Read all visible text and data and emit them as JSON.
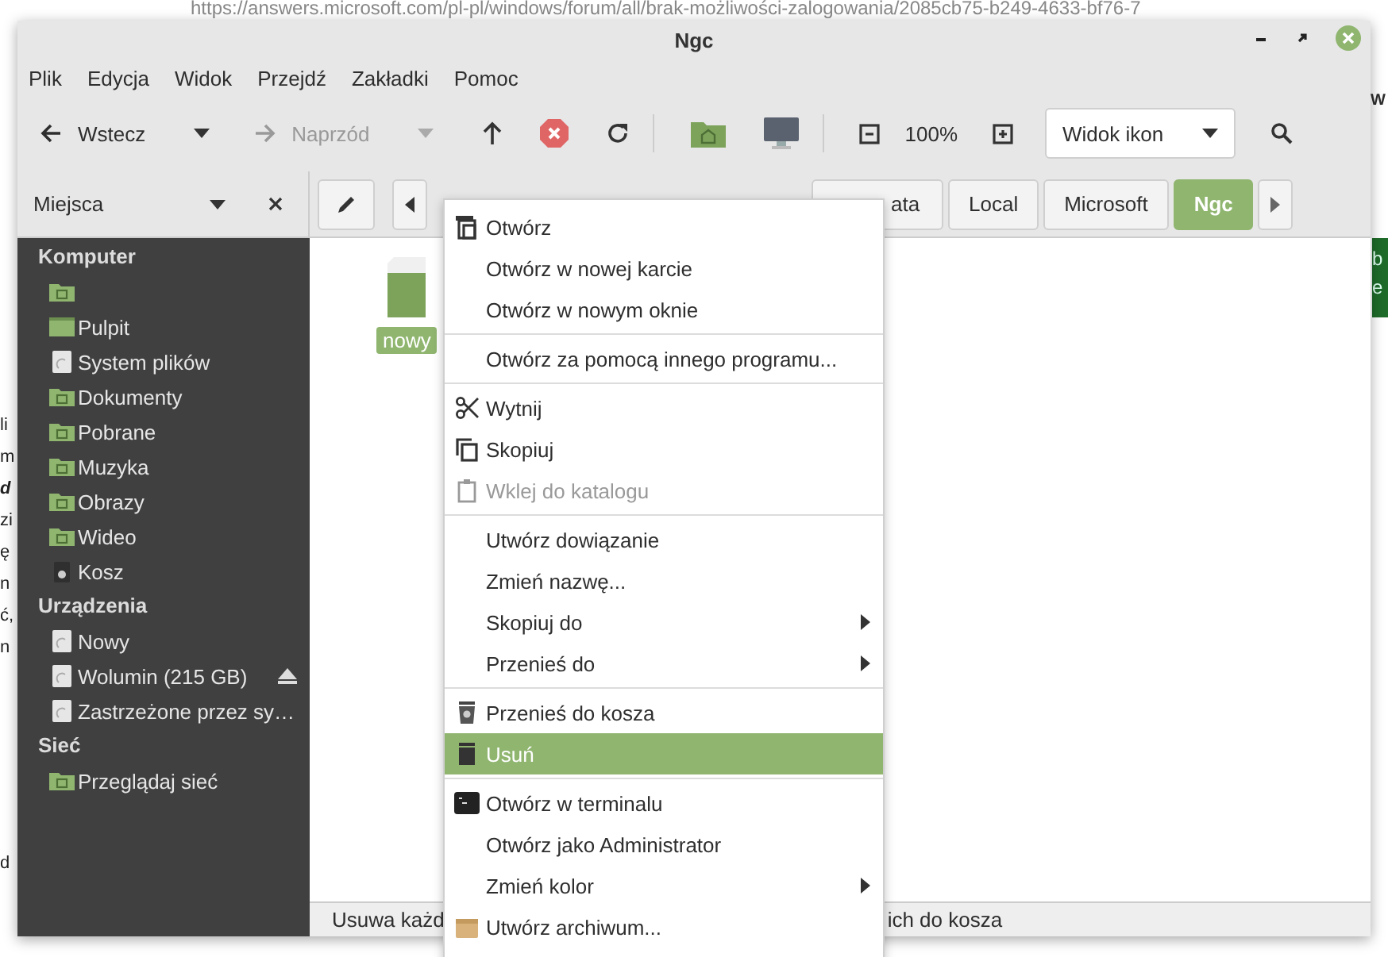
{
  "browser": {
    "url": "https://answers.microsoft.com/pl-pl/windows/forum/all/brak-możliwości-zalogowania/2085cb75-b249-4633-bf76-7",
    "left_fragments": [
      "li",
      "m",
      "d",
      "zi",
      "ę",
      "n",
      "ć,",
      "n"
    ],
    "bottom_fragment": "d",
    "right_fragment": "W",
    "right_box": [
      "b",
      "e"
    ]
  },
  "window": {
    "title": "Ngc"
  },
  "menubar": [
    "Plik",
    "Edycja",
    "Widok",
    "Przejdź",
    "Zakładki",
    "Pomoc"
  ],
  "toolbar": {
    "back": {
      "label": "Wstecz",
      "disabled": false
    },
    "forward": {
      "label": "Naprzód",
      "disabled": true
    },
    "zoom": "100%",
    "view": "Widok ikon"
  },
  "sidebar": {
    "title": "Miejsca",
    "sections": [
      {
        "heading": "Komputer",
        "items": [
          {
            "ejectable": false
          },
          {
            "label": "Pulpit",
            "ejectable": false
          },
          {
            "label": "System plików",
            "ejectable": false
          },
          {
            "label": "Dokumenty",
            "ejectable": false
          },
          {
            "label": "Pobrane",
            "ejectable": false
          },
          {
            "label": "Muzyka",
            "ejectable": false
          },
          {
            "label": "Obrazy",
            "ejectable": false
          },
          {
            "label": "Wideo",
            "ejectable": false
          },
          {
            "label": "Kosz",
            "ejectable": false
          }
        ]
      },
      {
        "heading": "Urządzenia",
        "items": [
          {
            "label": "Nowy",
            "ejectable": false
          },
          {
            "label": "Wolumin (215 GB)",
            "ejectable": true
          },
          {
            "label": "Zastrzeżone przez sy…",
            "ejectable": false
          }
        ]
      },
      {
        "heading": "Sieć",
        "items": [
          {
            "label": "Przeglądaj sieć",
            "ejectable": false
          }
        ]
      }
    ]
  },
  "pathbar": {
    "crumbs": [
      {
        "label": "ata",
        "selected": false
      },
      {
        "label": "Local",
        "selected": false
      },
      {
        "label": "Microsoft",
        "selected": false
      },
      {
        "label": "Ngc",
        "selected": true
      }
    ]
  },
  "files": [
    {
      "name": "nowy",
      "selected": true
    }
  ],
  "status": {
    "left": "Usuwa każd",
    "right": "ich do kosza"
  },
  "context_menu": [
    {
      "kind": "item",
      "label": "Otwórz",
      "selected": false,
      "disabled": false,
      "submenu": false
    },
    {
      "kind": "item",
      "label": "Otwórz w nowej karcie",
      "selected": false,
      "disabled": false,
      "submenu": false
    },
    {
      "kind": "item",
      "label": "Otwórz w nowym oknie",
      "selected": false,
      "disabled": false,
      "submenu": false
    },
    {
      "kind": "separator"
    },
    {
      "kind": "item",
      "label": "Otwórz za pomocą innego programu...",
      "selected": false,
      "disabled": false,
      "submenu": false
    },
    {
      "kind": "separator"
    },
    {
      "kind": "item",
      "label": "Wytnij",
      "selected": false,
      "disabled": false,
      "submenu": false
    },
    {
      "kind": "item",
      "label": "Skopiuj",
      "selected": false,
      "disabled": false,
      "submenu": false
    },
    {
      "kind": "item",
      "label": "Wklej do katalogu",
      "selected": false,
      "disabled": true,
      "submenu": false
    },
    {
      "kind": "separator"
    },
    {
      "kind": "item",
      "label": "Utwórz dowiązanie",
      "selected": false,
      "disabled": false,
      "submenu": false
    },
    {
      "kind": "item",
      "label": "Zmień nazwę...",
      "selected": false,
      "disabled": false,
      "submenu": false
    },
    {
      "kind": "item",
      "label": "Skopiuj do",
      "selected": false,
      "disabled": false,
      "submenu": true
    },
    {
      "kind": "item",
      "label": "Przenieś do",
      "selected": false,
      "disabled": false,
      "submenu": true
    },
    {
      "kind": "separator"
    },
    {
      "kind": "item",
      "label": "Przenieś do kosza",
      "selected": false,
      "disabled": false,
      "submenu": false
    },
    {
      "kind": "item",
      "label": "Usuń",
      "selected": true,
      "disabled": false,
      "submenu": false
    },
    {
      "kind": "separator"
    },
    {
      "kind": "item",
      "label": "Otwórz w terminalu",
      "selected": false,
      "disabled": false,
      "submenu": false
    },
    {
      "kind": "item",
      "label": "Otwórz jako Administrator",
      "selected": false,
      "disabled": false,
      "submenu": false
    },
    {
      "kind": "item",
      "label": "Zmień kolor",
      "selected": false,
      "disabled": false,
      "submenu": true
    },
    {
      "kind": "item",
      "label": "Utwórz archiwum...",
      "selected": false,
      "disabled": false,
      "submenu": false
    }
  ]
}
